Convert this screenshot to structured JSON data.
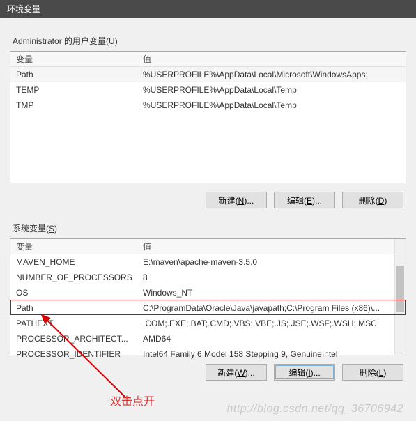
{
  "window": {
    "title": "环境变量"
  },
  "user_section": {
    "label_html": "Administrator 的用户变量(<span class='u'>U</span>)",
    "header": {
      "name": "变量",
      "value": "值"
    },
    "rows": [
      {
        "name": "Path",
        "value": "%USERPROFILE%\\AppData\\Local\\Microsoft\\WindowsApps;"
      },
      {
        "name": "TEMP",
        "value": "%USERPROFILE%\\AppData\\Local\\Temp"
      },
      {
        "name": "TMP",
        "value": "%USERPROFILE%\\AppData\\Local\\Temp"
      }
    ],
    "buttons": {
      "new_html": "新建(<span class='u'>N</span>)...",
      "edit_html": "编辑(<span class='u'>E</span>)...",
      "delete_html": "删除(<span class='u'>D</span>)"
    }
  },
  "system_section": {
    "label_html": "系统变量(<span class='u'>S</span>)",
    "header": {
      "name": "变量",
      "value": "值"
    },
    "rows": [
      {
        "name": "MAVEN_HOME",
        "value": "E:\\maven\\apache-maven-3.5.0"
      },
      {
        "name": "NUMBER_OF_PROCESSORS",
        "value": "8"
      },
      {
        "name": "OS",
        "value": "Windows_NT"
      },
      {
        "name": "Path",
        "value": "C:\\ProgramData\\Oracle\\Java\\javapath;C:\\Program Files (x86)\\..."
      },
      {
        "name": "PATHEXT",
        "value": ".COM;.EXE;.BAT;.CMD;.VBS;.VBE;.JS;.JSE;.WSF;.WSH;.MSC"
      },
      {
        "name": "PROCESSOR_ARCHITECT...",
        "value": "AMD64"
      },
      {
        "name": "PROCESSOR_IDENTIFIER",
        "value": "Intel64 Family 6 Model 158 Stepping 9, GenuineIntel"
      }
    ],
    "buttons": {
      "new_html": "新建(<span class='u'>W</span>)...",
      "edit_html": "编辑(<span class='u'>I</span>)...",
      "delete_html": "删除(<span class='u'>L</span>)"
    }
  },
  "annotation": {
    "text": "双击点开"
  },
  "watermark": {
    "text": "http://blog.csdn.net/qq_36706942"
  }
}
